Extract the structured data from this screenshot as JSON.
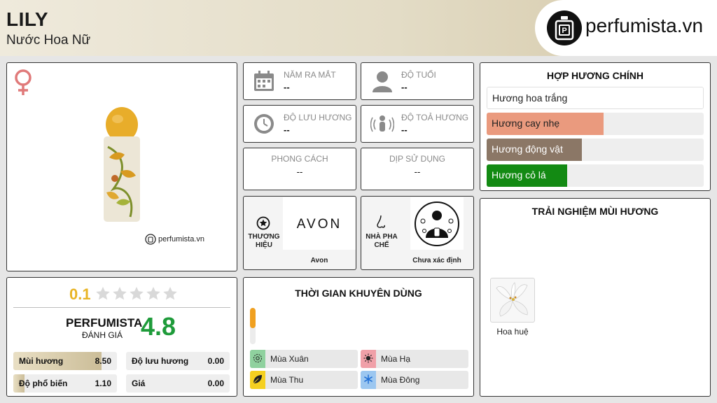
{
  "header": {
    "title": "LILY",
    "subtitle": "Nước Hoa Nữ",
    "brand_site": "perfumista.vn"
  },
  "product_card": {
    "gender_icon": "female-icon",
    "watermark": "perfumista.vn"
  },
  "info": {
    "release_year": {
      "label": "NĂM RA MẮT",
      "value": "--"
    },
    "age": {
      "label": "ĐỘ TUỔI",
      "value": "--"
    },
    "longevity": {
      "label": "ĐỘ LƯU HƯƠNG",
      "value": "--"
    },
    "sillage": {
      "label": "ĐỘ TOẢ HƯƠNG",
      "value": "--"
    },
    "style": {
      "label": "PHONG CÁCH",
      "value": "--"
    },
    "occasion": {
      "label": "DỊP SỬ DỤNG",
      "value": "--"
    }
  },
  "brand": {
    "label": "THƯƠNG HIỆU",
    "logo_text": "AVON",
    "name": "Avon"
  },
  "perfumer": {
    "label": "NHÀ PHA CHẾ",
    "name": "Chưa xác định"
  },
  "accords": {
    "title": "HỢP HƯƠNG CHÍNH",
    "items": [
      {
        "name": "Hương hoa trắng",
        "level": 1.0,
        "color": "#ffffff",
        "text_color": "#222222"
      },
      {
        "name": "Hương cay nhẹ",
        "level": 0.54,
        "color": "#ea9a7e",
        "text_color": "#222222"
      },
      {
        "name": "Hương động vật",
        "level": 0.44,
        "color": "#8b7766",
        "text_color": "#ffffff"
      },
      {
        "name": "Hương cỏ lá",
        "level": 0.37,
        "color": "#138a13",
        "text_color": "#ffffff"
      }
    ]
  },
  "experience": {
    "title": "TRẢI NGHIỆM MÙI HƯƠNG",
    "notes": [
      {
        "name": "Hoa huệ"
      }
    ]
  },
  "rating": {
    "user_score": "0.1",
    "stars_filled": 0,
    "stars_total": 5,
    "perfumista_label": "PERFUMISTA",
    "rating_label": "ĐÁNH GIÁ",
    "perfumista_score": "4.8",
    "details": [
      {
        "label": "Mùi hương",
        "value": "8.50",
        "level": 0.85
      },
      {
        "label": "Độ lưu hương",
        "value": "0.00",
        "level": 0.0
      },
      {
        "label": "Độ phổ biến",
        "value": "1.10",
        "level": 0.11
      },
      {
        "label": "Giá",
        "value": "0.00",
        "level": 0.0
      }
    ]
  },
  "seasons": {
    "title": "THỜI GIAN KHUYÊN DÙNG",
    "day_level": 0.55,
    "items": [
      {
        "name": "Mùa Xuân",
        "color": "#8fd19e",
        "icon": "flower-icon"
      },
      {
        "name": "Mùa Hạ",
        "color": "#f0a0a8",
        "icon": "sun-icon"
      },
      {
        "name": "Mùa Thu",
        "color": "#f5d020",
        "icon": "leaf-icon"
      },
      {
        "name": "Mùa Đông",
        "color": "#9cc7f0",
        "icon": "snowflake-icon"
      }
    ]
  }
}
